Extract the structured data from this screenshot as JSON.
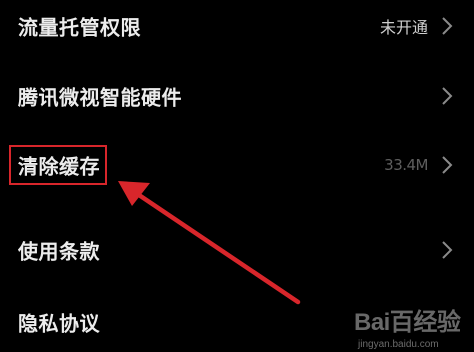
{
  "settings": {
    "items": [
      {
        "label": "流量托管权限",
        "value": "未开通"
      },
      {
        "label": "腾讯微视智能硬件",
        "value": ""
      },
      {
        "label": "清除缓存",
        "value": "33.4M"
      },
      {
        "label": "使用条款",
        "value": ""
      },
      {
        "label": "隐私协议",
        "value": ""
      }
    ]
  },
  "colors": {
    "background": "#000000",
    "text": "#ececec",
    "annotation_red": "#d8262b"
  },
  "icons": {
    "chevron": "chevron-right-icon"
  },
  "watermark": {
    "logo": "Bai百经验",
    "url": "jingyan.baidu.com"
  }
}
